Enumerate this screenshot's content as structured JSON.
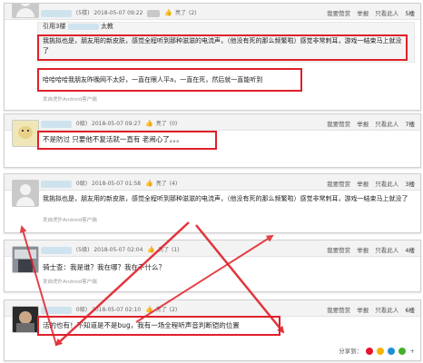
{
  "colors": {
    "annotation_red": "#e0202a",
    "header_bg": "#f3f3f3",
    "link_blue": "#3a6ea5"
  },
  "actions": {
    "top": "我要赞赏",
    "report": "举报",
    "only_view": "只看此人"
  },
  "post1": {
    "level": "(5楼)",
    "date": "2018-05-07 09:22",
    "like": "亮了",
    "count": "(2)",
    "floor": "5楼",
    "quote_author": "引用3楼",
    "quote_suffix": "太教",
    "quote_text": "我挑拟也是，朋友用的新皮肤，感觉全程听到那种滋滋的电流声，（他没有死的那么频繁啦）感觉非常刺耳，游戏一结束马上就没了",
    "reply_text": "哈哈哈哈我朋友昨晚网不太好，一直在眼人平a，一直在死，然后就一直能听到",
    "source": "发自虎扑Android客户端"
  },
  "post2": {
    "level": "0级)",
    "date": "2018-05-07 09:27",
    "like": "亮了",
    "count": "(0)",
    "floor": "7楼",
    "text": "不是防过 只要他不复活就一直有 老闹心了。。。"
  },
  "post3": {
    "level": "0级)",
    "date": "2018-05-07 01:58",
    "like": "亮了",
    "count": "(4)",
    "floor": "3楼",
    "text": "我挑拟也是，朋友用的新皮肤，感觉全程听到那种滋滋的电流声，（他没有死的那么频繁啦）感觉非常刺耳，游戏一结束马上就没了",
    "source": "发自虎扑Android客户端"
  },
  "post4": {
    "level": "(5级)",
    "date": "2018-05-07 02:04",
    "like": "亮了",
    "count": "(1)",
    "floor": "4楼",
    "text": "骑士查：我是谁？我在哪？我在干什么？",
    "source": "发自虎扑Android客户端"
  },
  "post5": {
    "level": "0级)",
    "date": "2018-05-07 02:10",
    "like": "亮了",
    "count": "(2)",
    "floor": "6楼",
    "text": "活的也有！不知道是不是bug，我有一场全程听声音判断铠的位置",
    "share": "分享到："
  }
}
